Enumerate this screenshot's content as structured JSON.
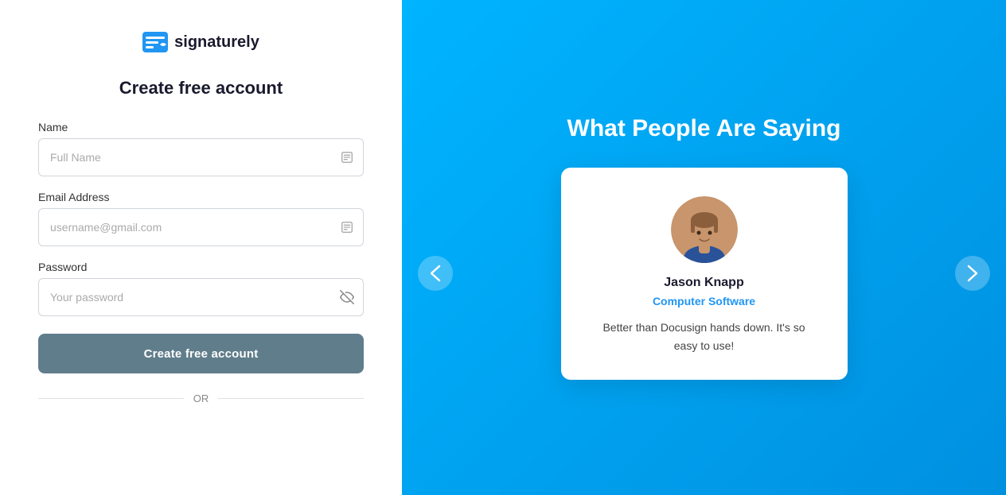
{
  "branding": {
    "logo_text": "signaturely"
  },
  "left": {
    "title": "Create free account",
    "fields": {
      "name": {
        "label": "Name",
        "placeholder": "Full Name"
      },
      "email": {
        "label": "Email Address",
        "placeholder": "username@gmail.com"
      },
      "password": {
        "label": "Password",
        "placeholder": "Your password"
      }
    },
    "submit_label": "Create free account",
    "divider_text": "OR"
  },
  "right": {
    "heading": "What People Are Saying",
    "testimonial": {
      "name": "Jason Knapp",
      "company": "Computer Software",
      "quote": "Better than Docusign hands down. It's so easy to use!"
    },
    "nav_prev": "‹",
    "nav_next": "›"
  }
}
